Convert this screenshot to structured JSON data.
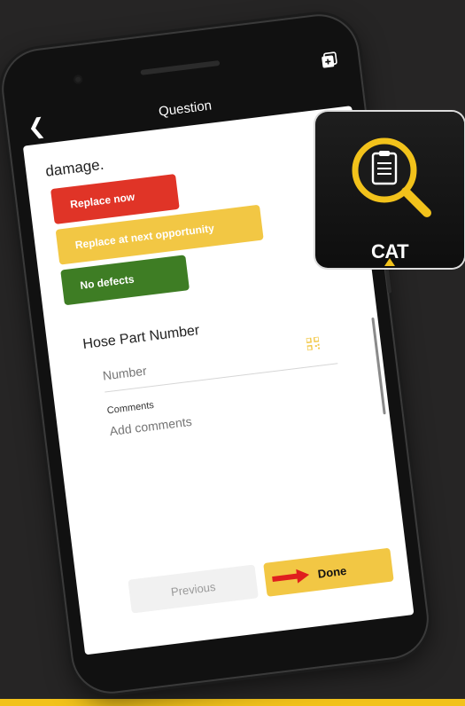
{
  "header": {
    "title": "Question"
  },
  "question": {
    "visible_text": "damage."
  },
  "severity_options": [
    {
      "label": "Replace now",
      "color": "#e03427"
    },
    {
      "label": "Replace at next opportunity",
      "color": "#f2c744"
    },
    {
      "label": "No defects",
      "color": "#3e7d24"
    }
  ],
  "hose_part": {
    "label": "Hose Part Number",
    "input_placeholder": "Number"
  },
  "comments": {
    "label": "Comments",
    "placeholder": "Add comments"
  },
  "navigation": {
    "previous_label": "Previous",
    "done_label": "Done"
  },
  "app_icon": {
    "brand": "CAT",
    "icon": "magnifier-clipboard-icon"
  },
  "colors": {
    "accent": "#f2c21b",
    "background": "#262525",
    "arrow": "#e01e1e"
  }
}
